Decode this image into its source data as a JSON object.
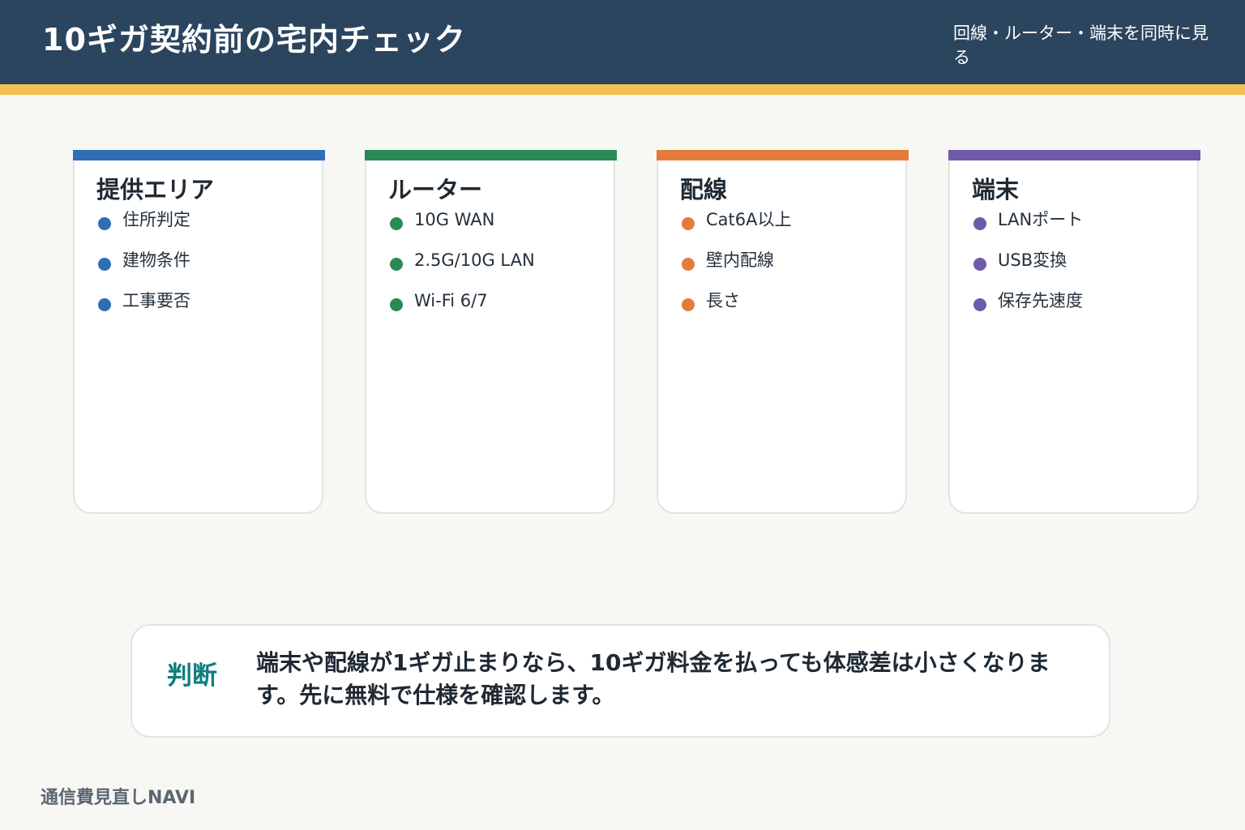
{
  "header": {
    "title": "10ギガ契約前の宅内チェック",
    "subtitle": "回線・ルーター・端末を同時に見る"
  },
  "colors": {
    "header_bg": "#2b455f",
    "header_accent": "#f2c14e",
    "area": "#2f6db5",
    "router": "#2a8a55",
    "wiring": "#e47b3d",
    "device": "#6e5aa8",
    "verdict_label": "#0f7c80"
  },
  "cards": [
    {
      "title": "提供エリア",
      "color": "#2f6db5",
      "items": [
        "住所判定",
        "建物条件",
        "工事要否"
      ]
    },
    {
      "title": "ルーター",
      "color": "#2a8a55",
      "items": [
        "10G WAN",
        "2.5G/10G LAN",
        "Wi-Fi 6/7"
      ]
    },
    {
      "title": "配線",
      "color": "#e47b3d",
      "items": [
        "Cat6A以上",
        "壁内配線",
        "長さ"
      ]
    },
    {
      "title": "端末",
      "color": "#6e5aa8",
      "items": [
        "LANポート",
        "USB変換",
        "保存先速度"
      ]
    }
  ],
  "verdict": {
    "label": "判断",
    "text": "端末や配線が1ギガ止まりなら、10ギガ料金を払っても体感差は小さくなります。先に無料で仕様を確認します。"
  },
  "footer": {
    "brand": "通信費見直しNAVI"
  }
}
